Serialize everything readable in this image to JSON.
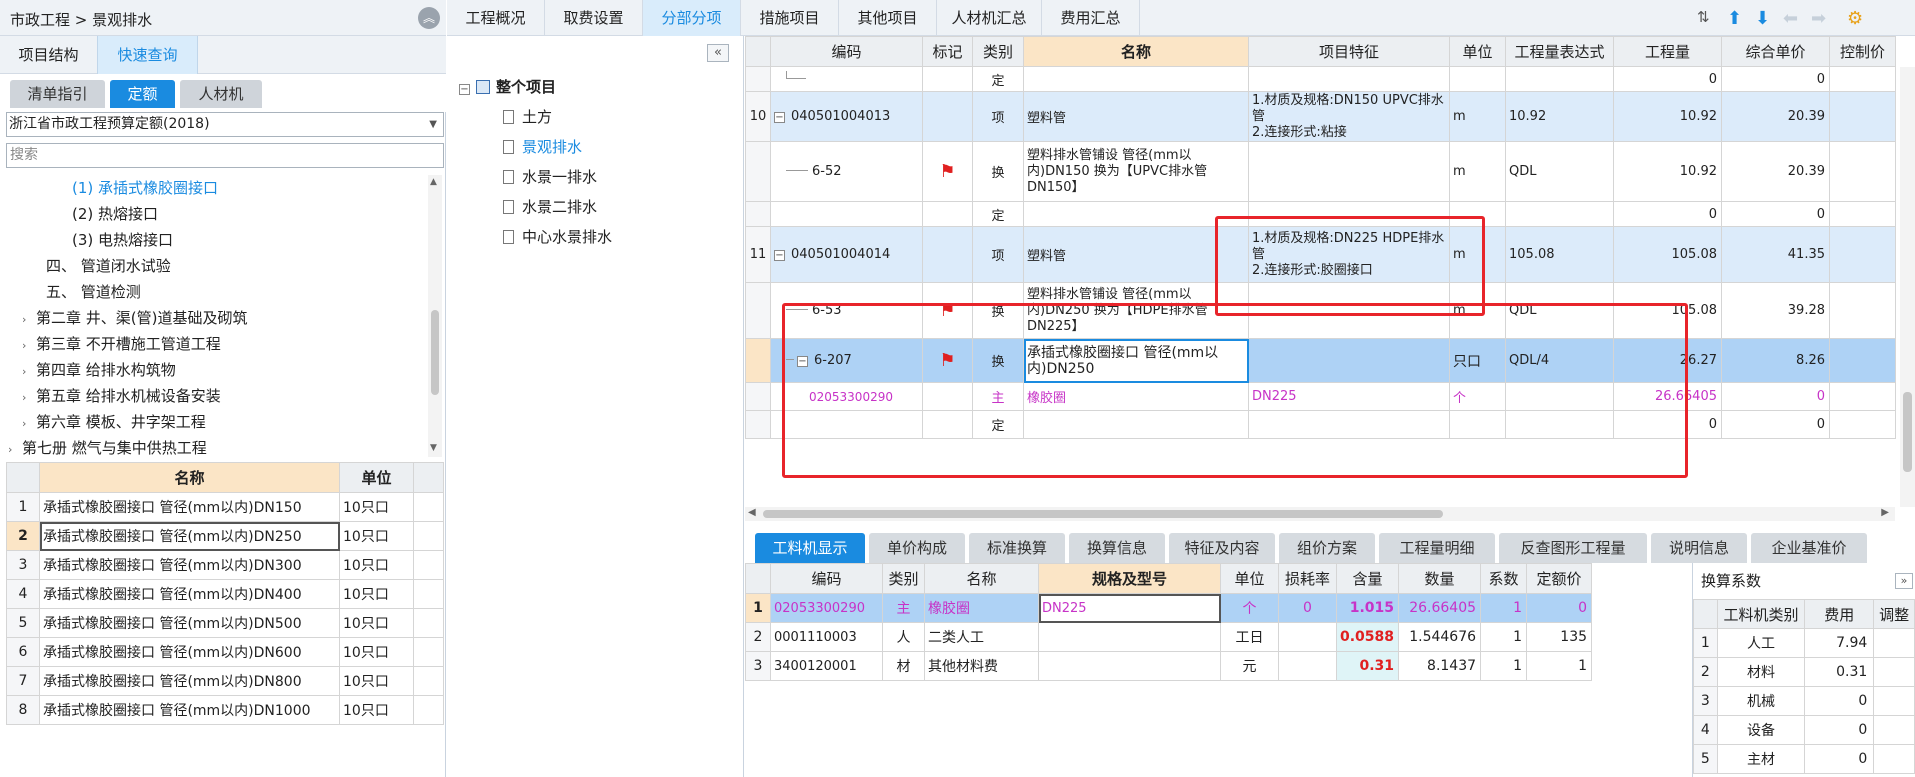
{
  "left": {
    "breadcrumb": "市政工程 > 景观排水",
    "tabs": [
      "项目结构",
      "快速查询"
    ],
    "subtabs": [
      "清单指引",
      "定额",
      "人材机"
    ],
    "quota_select": "浙江省市政工程预算定额(2018)",
    "search_placeholder": "搜索",
    "tree": [
      {
        "label": "(1) 承插式橡胶圈接口"
      },
      {
        "label": "(2) 热熔接口"
      },
      {
        "label": "(3) 电热熔接口"
      },
      {
        "label": "四、 管道闭水试验"
      },
      {
        "label": "五、 管道检测"
      },
      {
        "label": "第二章 井、渠(管)道基础及砌筑"
      },
      {
        "label": "第三章 不开槽施工管道工程"
      },
      {
        "label": "第四章 给排水构筑物"
      },
      {
        "label": "第五章 给排水机械设备安装"
      },
      {
        "label": "第六章 模板、井字架工程"
      },
      {
        "label": "第七册 燃气与集中供热工程"
      }
    ],
    "table": {
      "headers": [
        "名称",
        "单位"
      ],
      "rows": [
        {
          "no": "1",
          "name": "承插式橡胶圈接口 管径(mm以内)DN150",
          "unit": "10只口"
        },
        {
          "no": "2",
          "name": "承插式橡胶圈接口 管径(mm以内)DN250",
          "unit": "10只口"
        },
        {
          "no": "3",
          "name": "承插式橡胶圈接口 管径(mm以内)DN300",
          "unit": "10只口"
        },
        {
          "no": "4",
          "name": "承插式橡胶圈接口 管径(mm以内)DN400",
          "unit": "10只口"
        },
        {
          "no": "5",
          "name": "承插式橡胶圈接口 管径(mm以内)DN500",
          "unit": "10只口"
        },
        {
          "no": "6",
          "name": "承插式橡胶圈接口 管径(mm以内)DN600",
          "unit": "10只口"
        },
        {
          "no": "7",
          "name": "承插式橡胶圈接口 管径(mm以内)DN800",
          "unit": "10只口"
        },
        {
          "no": "8",
          "name": "承插式橡胶圈接口 管径(mm以内)DN1000",
          "unit": "10只口"
        }
      ]
    }
  },
  "mid": {
    "root": "整个项目",
    "items": [
      "土方",
      "景观排水",
      "水景一排水",
      "水景二排水",
      "中心水景排水"
    ],
    "collapse_icon": "«"
  },
  "toptabs": [
    "工程概况",
    "取费设置",
    "分部分项",
    "措施项目",
    "其他项目",
    "人材机汇总",
    "费用汇总"
  ],
  "grid": {
    "headers": [
      "编码",
      "标记",
      "类别",
      "名称",
      "项目特征",
      "单位",
      "工程量表达式",
      "工程量",
      "综合单价",
      "控制价"
    ],
    "rows": [
      {
        "idx": "",
        "code": "",
        "type": "定",
        "name": "",
        "feat": "",
        "unit": "",
        "expr": "",
        "qty": "0",
        "price": "0"
      },
      {
        "idx": "10",
        "code": "040501004013",
        "type": "项",
        "name": "塑料管",
        "feat": "1.材质及规格:DN150 UPVC排水管\n2.连接形式:粘接",
        "unit": "m",
        "expr": "10.92",
        "qty": "10.92",
        "price": "20.39"
      },
      {
        "idx": "",
        "code": "6-52",
        "type": "换",
        "name": "塑料排水管铺设 管径(mm以内)DN150  换为【UPVC排水管DN150】",
        "feat": "",
        "unit": "m",
        "expr": "QDL",
        "qty": "10.92",
        "price": "20.39"
      },
      {
        "idx": "",
        "code": "",
        "type": "定",
        "name": "",
        "feat": "",
        "unit": "",
        "expr": "",
        "qty": "0",
        "price": "0"
      },
      {
        "idx": "11",
        "code": "040501004014",
        "type": "项",
        "name": "塑料管",
        "feat": "1.材质及规格:DN225 HDPE排水管\n2.连接形式:胶圈接口",
        "unit": "m",
        "expr": "105.08",
        "qty": "105.08",
        "price": "41.35"
      },
      {
        "idx": "",
        "code": "6-53",
        "type": "换",
        "name": "塑料排水管铺设 管径(mm以内)DN250  换为【HDPE排水管DN225】",
        "feat": "",
        "unit": "m",
        "expr": "QDL",
        "qty": "105.08",
        "price": "39.28"
      },
      {
        "idx": "",
        "code": "6-207",
        "type": "换",
        "name": "承插式橡胶圈接口 管径(mm以内)DN250",
        "feat": "",
        "unit": "只口",
        "expr": "QDL/4",
        "qty": "26.27",
        "price": "8.26"
      },
      {
        "idx": "",
        "code": "02053300290",
        "type": "主",
        "name": "橡胶圈",
        "feat": "DN225",
        "unit": "个",
        "expr": "",
        "qty": "26.66405",
        "price": "0"
      },
      {
        "idx": "",
        "code": "",
        "type": "定",
        "name": "",
        "feat": "",
        "unit": "",
        "expr": "",
        "qty": "0",
        "price": "0"
      }
    ]
  },
  "btabs": [
    "工料机显示",
    "单价构成",
    "标准换算",
    "换算信息",
    "特征及内容",
    "组价方案",
    "工程量明细",
    "反查图形工程量",
    "说明信息",
    "企业基准价"
  ],
  "bgrid": {
    "headers": [
      "编码",
      "类别",
      "名称",
      "规格及型号",
      "单位",
      "损耗率",
      "含量",
      "数量",
      "系数",
      "定额价"
    ],
    "rows": [
      {
        "no": "1",
        "code": "02053300290",
        "type": "主",
        "name": "橡胶圈",
        "spec": "DN225",
        "unit": "个",
        "loss": "0",
        "content": "1.015",
        "qty": "26.66405",
        "coef": "1",
        "price": "0"
      },
      {
        "no": "2",
        "code": "0001110003",
        "type": "人",
        "name": "二类人工",
        "spec": "",
        "unit": "工日",
        "loss": "",
        "content": "0.0588",
        "qty": "1.544676",
        "coef": "1",
        "price": "135"
      },
      {
        "no": "3",
        "code": "3400120001",
        "type": "材",
        "name": "其他材料费",
        "spec": "",
        "unit": "元",
        "loss": "",
        "content": "0.31",
        "qty": "8.1437",
        "coef": "1",
        "price": "1"
      }
    ]
  },
  "rpanel": {
    "title": "换算系数",
    "headers": [
      "工料机类别",
      "费用",
      "调整"
    ],
    "rows": [
      {
        "no": "1",
        "cat": "人工",
        "fee": "7.94"
      },
      {
        "no": "2",
        "cat": "材料",
        "fee": "0.31"
      },
      {
        "no": "3",
        "cat": "机械",
        "fee": "0"
      },
      {
        "no": "4",
        "cat": "设备",
        "fee": "0"
      },
      {
        "no": "5",
        "cat": "主材",
        "fee": "0"
      }
    ]
  }
}
